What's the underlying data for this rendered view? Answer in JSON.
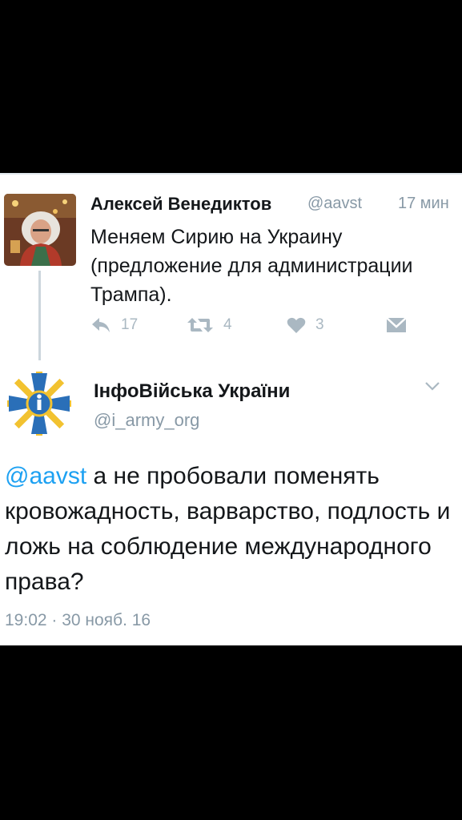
{
  "parent": {
    "name": "Алексей Венедиктов",
    "handle": "@aavst",
    "time": "17 мин",
    "text": "Меняем Сирию на Украину (предложение для администрации Трампа).",
    "reply_count": "17",
    "retweet_count": "4",
    "like_count": "3"
  },
  "reply": {
    "name": "ІнфоВійська України",
    "handle": "@i_army_org",
    "mention": "@aavst",
    "text": " а не пробовали поменять кровожадность, варварство, подлость и ложь на соблюдение международного права?",
    "meta": "19:02 · 30 нояб. 16"
  },
  "colors": {
    "mention": "#1da1f2",
    "secondary": "#8899a6",
    "icon": "#aab8c2",
    "emblem": "#2a6fb8"
  }
}
